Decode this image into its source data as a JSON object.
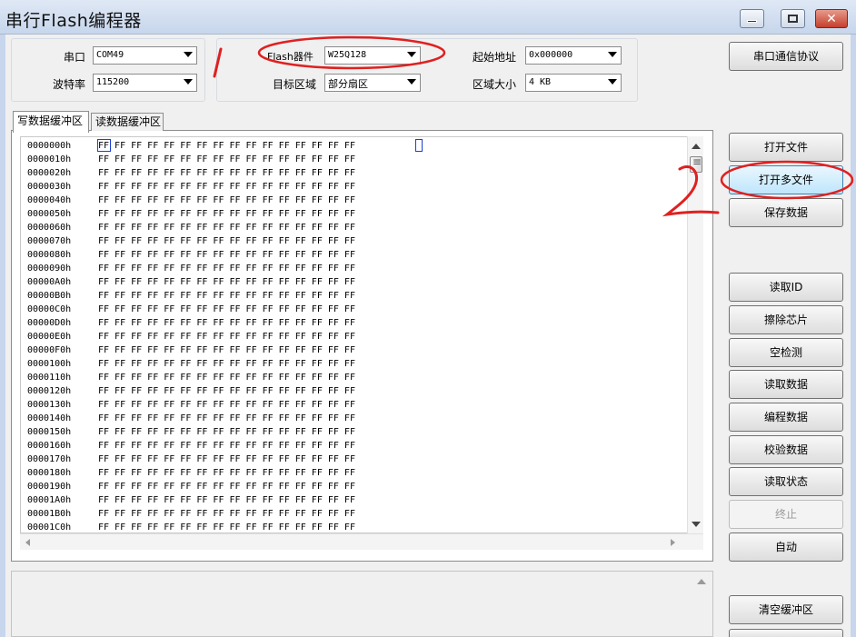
{
  "window": {
    "title": "串行Flash编程器",
    "controls": [
      "minimize-button",
      "maximize-button",
      "close-button"
    ]
  },
  "serial_group": {
    "port_label": "串口",
    "port_value": "COM49",
    "baud_label": "波特率",
    "baud_value": "115200"
  },
  "flash_group": {
    "device_label": "Flash器件",
    "device_value": "W25Q128",
    "target_label": "目标区域",
    "target_value": "部分扇区",
    "start_label": "起始地址",
    "start_value": "0x000000",
    "size_label": "区域大小",
    "size_value": "4 KB"
  },
  "protocol_button": "串口通信协议",
  "tabs": [
    {
      "label": "写数据缓冲区",
      "active": true
    },
    {
      "label": "读数据缓冲区",
      "active": false
    }
  ],
  "hex_rows": [
    {
      "addr": "0000000h",
      "bytes": "FF FF FF FF FF FF FF FF FF FF FF FF FF FF FF FF"
    },
    {
      "addr": "0000010h",
      "bytes": "FF FF FF FF FF FF FF FF FF FF FF FF FF FF FF FF"
    },
    {
      "addr": "0000020h",
      "bytes": "FF FF FF FF FF FF FF FF FF FF FF FF FF FF FF FF"
    },
    {
      "addr": "0000030h",
      "bytes": "FF FF FF FF FF FF FF FF FF FF FF FF FF FF FF FF"
    },
    {
      "addr": "0000040h",
      "bytes": "FF FF FF FF FF FF FF FF FF FF FF FF FF FF FF FF"
    },
    {
      "addr": "0000050h",
      "bytes": "FF FF FF FF FF FF FF FF FF FF FF FF FF FF FF FF"
    },
    {
      "addr": "0000060h",
      "bytes": "FF FF FF FF FF FF FF FF FF FF FF FF FF FF FF FF"
    },
    {
      "addr": "0000070h",
      "bytes": "FF FF FF FF FF FF FF FF FF FF FF FF FF FF FF FF"
    },
    {
      "addr": "0000080h",
      "bytes": "FF FF FF FF FF FF FF FF FF FF FF FF FF FF FF FF"
    },
    {
      "addr": "0000090h",
      "bytes": "FF FF FF FF FF FF FF FF FF FF FF FF FF FF FF FF"
    },
    {
      "addr": "00000A0h",
      "bytes": "FF FF FF FF FF FF FF FF FF FF FF FF FF FF FF FF"
    },
    {
      "addr": "00000B0h",
      "bytes": "FF FF FF FF FF FF FF FF FF FF FF FF FF FF FF FF"
    },
    {
      "addr": "00000C0h",
      "bytes": "FF FF FF FF FF FF FF FF FF FF FF FF FF FF FF FF"
    },
    {
      "addr": "00000D0h",
      "bytes": "FF FF FF FF FF FF FF FF FF FF FF FF FF FF FF FF"
    },
    {
      "addr": "00000E0h",
      "bytes": "FF FF FF FF FF FF FF FF FF FF FF FF FF FF FF FF"
    },
    {
      "addr": "00000F0h",
      "bytes": "FF FF FF FF FF FF FF FF FF FF FF FF FF FF FF FF"
    },
    {
      "addr": "0000100h",
      "bytes": "FF FF FF FF FF FF FF FF FF FF FF FF FF FF FF FF"
    },
    {
      "addr": "0000110h",
      "bytes": "FF FF FF FF FF FF FF FF FF FF FF FF FF FF FF FF"
    },
    {
      "addr": "0000120h",
      "bytes": "FF FF FF FF FF FF FF FF FF FF FF FF FF FF FF FF"
    },
    {
      "addr": "0000130h",
      "bytes": "FF FF FF FF FF FF FF FF FF FF FF FF FF FF FF FF"
    },
    {
      "addr": "0000140h",
      "bytes": "FF FF FF FF FF FF FF FF FF FF FF FF FF FF FF FF"
    },
    {
      "addr": "0000150h",
      "bytes": "FF FF FF FF FF FF FF FF FF FF FF FF FF FF FF FF"
    },
    {
      "addr": "0000160h",
      "bytes": "FF FF FF FF FF FF FF FF FF FF FF FF FF FF FF FF"
    },
    {
      "addr": "0000170h",
      "bytes": "FF FF FF FF FF FF FF FF FF FF FF FF FF FF FF FF"
    },
    {
      "addr": "0000180h",
      "bytes": "FF FF FF FF FF FF FF FF FF FF FF FF FF FF FF FF"
    },
    {
      "addr": "0000190h",
      "bytes": "FF FF FF FF FF FF FF FF FF FF FF FF FF FF FF FF"
    },
    {
      "addr": "00001A0h",
      "bytes": "FF FF FF FF FF FF FF FF FF FF FF FF FF FF FF FF"
    },
    {
      "addr": "00001B0h",
      "bytes": "FF FF FF FF FF FF FF FF FF FF FF FF FF FF FF FF"
    },
    {
      "addr": "00001C0h",
      "bytes": "FF FF FF FF FF FF FF FF FF FF FF FF FF FF FF FF"
    }
  ],
  "side_buttons": {
    "open_file": "打开文件",
    "open_multi": "打开多文件",
    "save_data": "保存数据",
    "read_id": "读取ID",
    "erase_chip": "擦除芯片",
    "blank_check": "空检测",
    "read_data": "读取数据",
    "program_data": "编程数据",
    "verify_data": "校验数据",
    "read_status": "读取状态",
    "stop": "终止",
    "auto": "自动",
    "clear_buffer": "清空缓冲区"
  },
  "annotations": {
    "mark_1": "1",
    "mark_2": "2",
    "color": "#e02020"
  }
}
